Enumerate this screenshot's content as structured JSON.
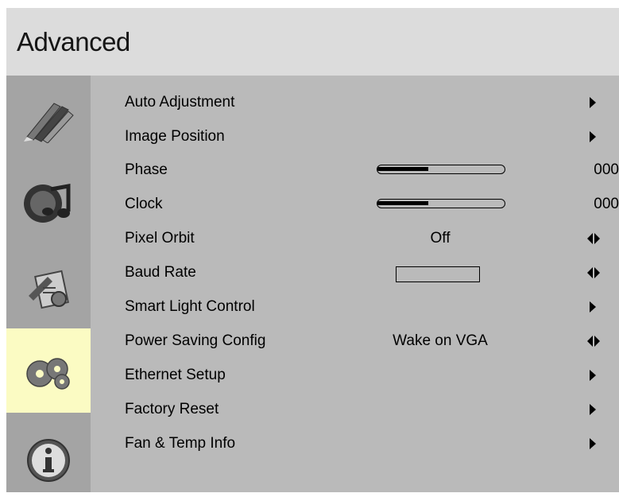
{
  "title": "Advanced",
  "categories": [
    {
      "icon": "color-pencils-icon",
      "selected": false
    },
    {
      "icon": "audio-music-icon",
      "selected": false
    },
    {
      "icon": "setup-tools-icon",
      "selected": false
    },
    {
      "icon": "advanced-gears-icon",
      "selected": true
    },
    {
      "icon": "info-icon",
      "selected": false
    }
  ],
  "menu": {
    "items": [
      {
        "label": "Auto Adjustment",
        "control": "submenu-arrow"
      },
      {
        "label": "Image Position",
        "control": "submenu-arrow"
      },
      {
        "label": "Phase",
        "control": "slider",
        "value": "000",
        "level": 0.4
      },
      {
        "label": "Clock",
        "control": "slider",
        "value": "000",
        "level": 0.4
      },
      {
        "label": "Pixel Orbit",
        "control": "option-arrows",
        "value": "Off"
      },
      {
        "label": "Baud Rate",
        "control": "option-arrows",
        "value": ""
      },
      {
        "label": "Smart Light Control",
        "control": "submenu-arrow"
      },
      {
        "label": "Power Saving Config",
        "control": "option-arrows",
        "value": "Wake on VGA"
      },
      {
        "label": "Ethernet Setup",
        "control": "submenu-arrow"
      },
      {
        "label": "Factory Reset",
        "control": "submenu-arrow"
      },
      {
        "label": "Fan & Temp Info",
        "control": "submenu-arrow"
      }
    ]
  }
}
